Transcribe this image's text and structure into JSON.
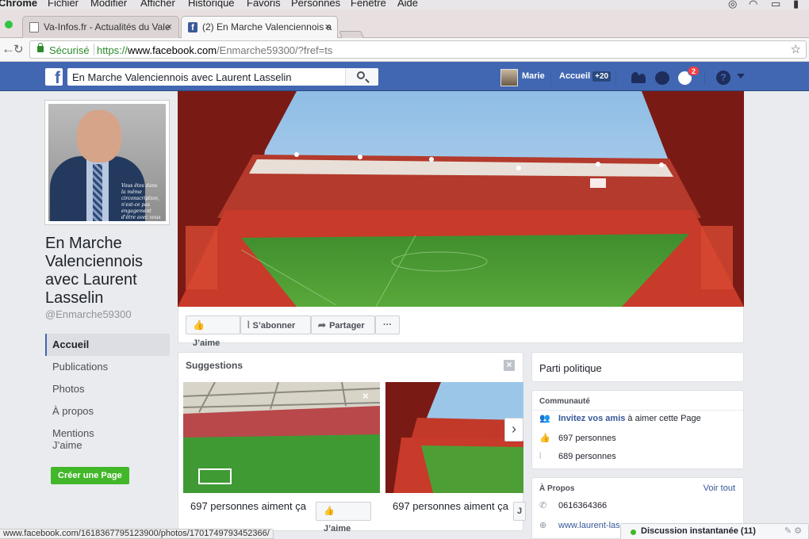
{
  "mac_menu": {
    "app": "Chrome",
    "items": [
      "Fichier",
      "Modifier",
      "Afficher",
      "Historique",
      "Favoris",
      "Personnes",
      "Fenêtre",
      "Aide"
    ]
  },
  "browser": {
    "tabs": [
      {
        "title": "Va-Infos.fr - Actualités du Vale",
        "active": false
      },
      {
        "title": "(2) En Marche Valenciennois a",
        "active": true
      }
    ],
    "close_glyph": "×",
    "secure_label": "Sécurisé",
    "url": {
      "protocol": "https://",
      "host": "www.facebook.com",
      "path": "/Enmarche59300/?fref=ts"
    },
    "status_url": "www.facebook.com/1618367795123900/photos/1701749793452366/"
  },
  "fb_header": {
    "search_value": "En Marche Valenciennois avec Laurent Lasselin",
    "user_name": "Marie",
    "home_label": "Accueil",
    "home_badge": "+20",
    "notification_count": "2",
    "help_glyph": "?",
    "icons": [
      "friend-requests-icon",
      "messenger-icon",
      "notifications-globe-icon",
      "help-icon"
    ]
  },
  "page": {
    "name": "En Marche Valenciennois avec Laurent Lasselin",
    "handle": "@Enmarche59300",
    "photo_note": "Vous êtes dans la même circonscription, n'est-ce pas engagement d'être avec vous !",
    "nav": [
      "Accueil",
      "Publications",
      "Photos",
      "À propos",
      "Mentions J’aime"
    ],
    "active_nav": "Accueil",
    "create_page_label": "Créer une Page"
  },
  "cover_actions": {
    "like_label": "J’aime",
    "subscribe_label": "S’abonner",
    "share_label": "Partager",
    "more_label": "···"
  },
  "suggestions": {
    "title": "Suggestions",
    "items": [
      {
        "likes_text": "697 personnes aiment ça",
        "like_label": "J’aime"
      },
      {
        "likes_text": "697 personnes aiment ça",
        "like_label": "J"
      }
    ]
  },
  "right_column": {
    "category": "Parti politique",
    "community": {
      "title": "Communauté",
      "invite_link": "Invitez vos amis",
      "invite_suffix": " à aimer cette Page",
      "likes": "697 personnes",
      "followers": "689 personnes"
    },
    "about": {
      "title": "À Propos",
      "see_all": "Voir tout",
      "phone": "0616364366",
      "website": "www.laurent-las"
    }
  },
  "chat": {
    "label": "Discussion instantanée (11)"
  },
  "colors": {
    "fb_blue": "#4267b2",
    "link": "#365899",
    "green": "#42b72a",
    "chrome_green": "#2b8a2b"
  }
}
